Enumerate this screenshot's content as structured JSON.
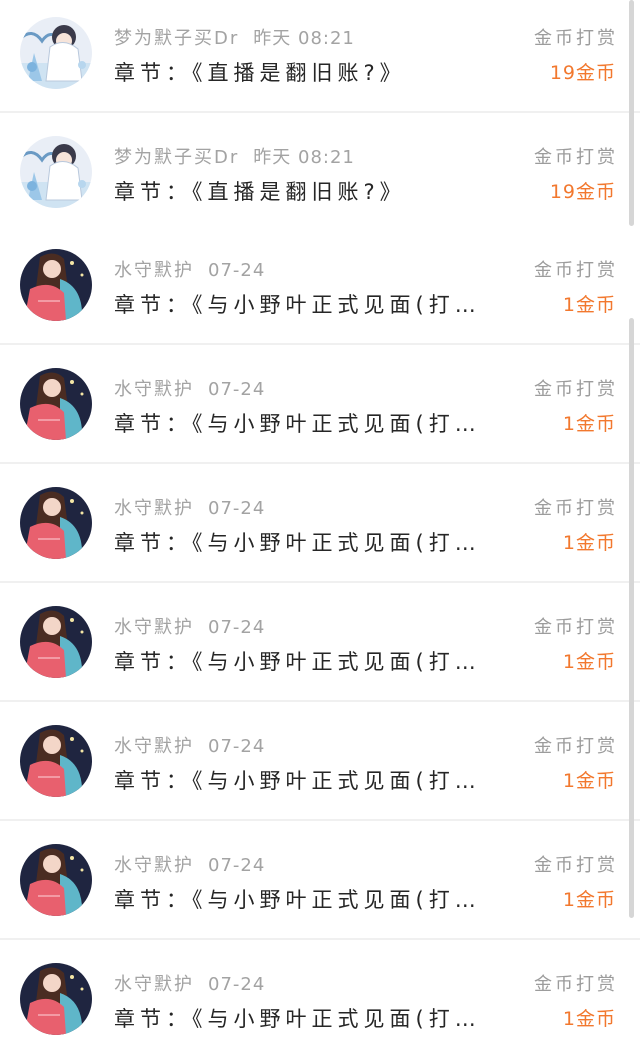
{
  "colors": {
    "amount": "#f2782e",
    "meta": "#a3a3a3",
    "title": "#262626",
    "divider": "#f0f0f0",
    "scrollbar": "#d6d6d6"
  },
  "rows": [
    {
      "avatar": "avatar-girl-white-hair",
      "user": "梦为默子买Dr",
      "time": "昨天 08:21",
      "chapter": "章节：《直播是翻旧账?》",
      "type": "金币打赏",
      "amount": "19金币"
    },
    {
      "avatar": "avatar-girl-white-hair",
      "user": "梦为默子买Dr",
      "time": "昨天 08:21",
      "chapter": "章节：《直播是翻旧账?》",
      "type": "金币打赏",
      "amount": "19金币"
    },
    {
      "avatar": "avatar-girl-pink-dress",
      "user": "水守默护",
      "time": "07-24",
      "chapter": "章节：《与小野叶正式见面(打…",
      "type": "金币打赏",
      "amount": "1金币"
    },
    {
      "avatar": "avatar-girl-pink-dress",
      "user": "水守默护",
      "time": "07-24",
      "chapter": "章节：《与小野叶正式见面(打…",
      "type": "金币打赏",
      "amount": "1金币"
    },
    {
      "avatar": "avatar-girl-pink-dress",
      "user": "水守默护",
      "time": "07-24",
      "chapter": "章节：《与小野叶正式见面(打…",
      "type": "金币打赏",
      "amount": "1金币"
    },
    {
      "avatar": "avatar-girl-pink-dress",
      "user": "水守默护",
      "time": "07-24",
      "chapter": "章节：《与小野叶正式见面(打…",
      "type": "金币打赏",
      "amount": "1金币"
    },
    {
      "avatar": "avatar-girl-pink-dress",
      "user": "水守默护",
      "time": "07-24",
      "chapter": "章节：《与小野叶正式见面(打…",
      "type": "金币打赏",
      "amount": "1金币"
    },
    {
      "avatar": "avatar-girl-pink-dress",
      "user": "水守默护",
      "time": "07-24",
      "chapter": "章节：《与小野叶正式见面(打…",
      "type": "金币打赏",
      "amount": "1金币"
    },
    {
      "avatar": "avatar-girl-pink-dress",
      "user": "水守默护",
      "time": "07-24",
      "chapter": "章节：《与小野叶正式见面(打…",
      "type": "金币打赏",
      "amount": "1金币"
    }
  ]
}
